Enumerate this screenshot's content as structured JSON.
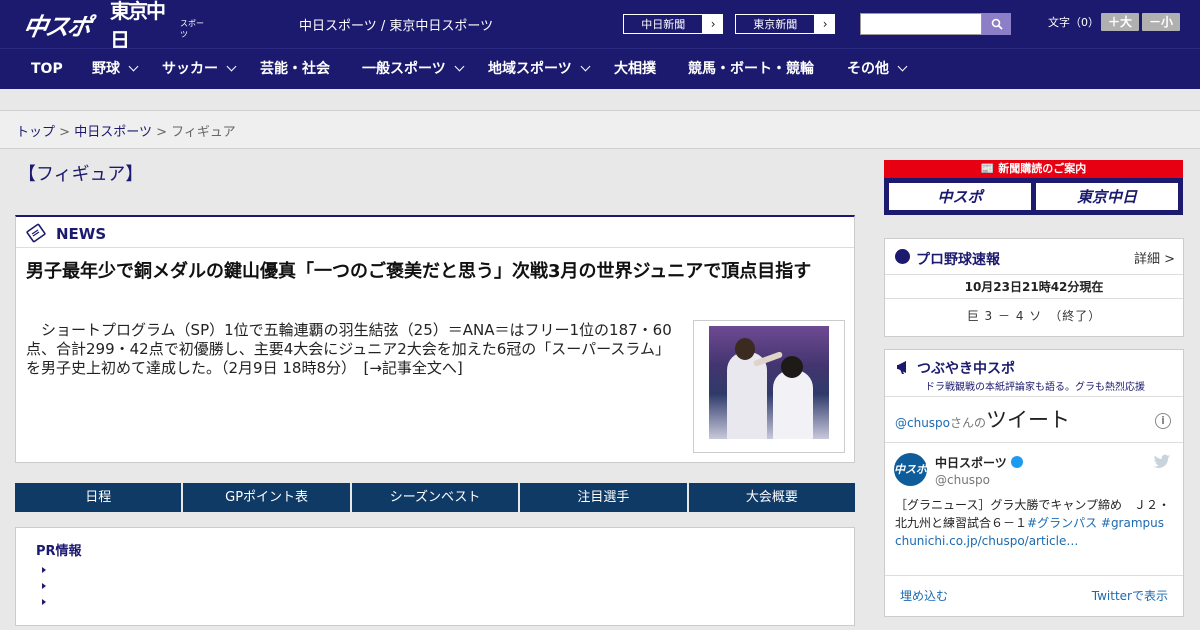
{
  "header": {
    "logo_chuspo": "中スポ",
    "logo_tokyo": "東京中日",
    "logo_tokyo_sub": "スポーツ",
    "site_title": "中日スポーツ / 東京中日スポーツ",
    "ext_links": [
      "中日新聞",
      "東京新聞"
    ],
    "font_label": "文字（0）",
    "font_plus": "＋大",
    "font_minus": "－小",
    "search_icon": "search-icon"
  },
  "nav": {
    "items": [
      {
        "label": "TOP",
        "has_menu": false
      },
      {
        "label": "野球",
        "has_menu": true
      },
      {
        "label": "サッカー",
        "has_menu": true
      },
      {
        "label": "芸能・社会",
        "has_menu": false
      },
      {
        "label": "一般スポーツ",
        "has_menu": true
      },
      {
        "label": "地域スポーツ",
        "has_menu": true
      },
      {
        "label": "大相撲",
        "has_menu": false
      },
      {
        "label": "競馬・ボート・競輪",
        "has_menu": false
      },
      {
        "label": "その他",
        "has_menu": true
      }
    ]
  },
  "breadcrumb": {
    "items": [
      "トップ",
      "中日スポーツ",
      "フィギュア"
    ],
    "separator": ">"
  },
  "page_heading": "【フィギュア】",
  "news": {
    "section_title": "NEWS",
    "headline": "男子最年少で銅メダルの鍵山優真「一つのご褒美だと思う」次戦3月の世界ジュニアで頂点目指す",
    "body": "　ショートプログラム（SP）1位で五輪連覇の羽生結弦（25）＝ANA＝はフリー1位の187・60点、合計299・42点で初優勝し、主要4大会にジュニア2大会を加えた6冠の「スーパースラム」を男子史上初めて達成した。（2月9日 18時8分）　[→記事全文へ]"
  },
  "tabs": [
    "日程",
    "GPポイント表",
    "シーズンベスト",
    "注目選手",
    "大会概要"
  ],
  "pr": {
    "title": "PR情報"
  },
  "subscription": {
    "top_label": "新聞購読のご案内",
    "btn1": "中スポ",
    "btn2": "東京中日"
  },
  "baseball": {
    "title": "プロ野球速報",
    "detail": "詳細 >",
    "timestamp": "10月23日21時42分現在",
    "game": "巨 3 － 4 ソ　（終了）"
  },
  "tweets": {
    "title": "つぶやき中スポ",
    "subtitle": "ドラ戦観戦の本紙評論家も語る。グラも熱烈応援",
    "handle": "@chuspo",
    "handle_suffix": "さんの",
    "tweet_word": "ツイート",
    "info_label": "i",
    "user_name": "中日スポーツ",
    "user_at": "@chuspo",
    "avatar_text": "中スポ",
    "text_plain": "［グラニュース］グラ大勝でキャンプ締め　Ｊ２・北九州と練習試合６－１",
    "text_tags": "#グランパス #grampus",
    "text_link": "chunichi.co.jp/chuspo/article…",
    "embed": "埋め込む",
    "view_on": "Twitterで表示"
  },
  "colors": {
    "brand": "#1c1a6e",
    "tab_bg": "#0f3a66",
    "accent_red": "#e60012",
    "link": "#1b6ab0"
  }
}
